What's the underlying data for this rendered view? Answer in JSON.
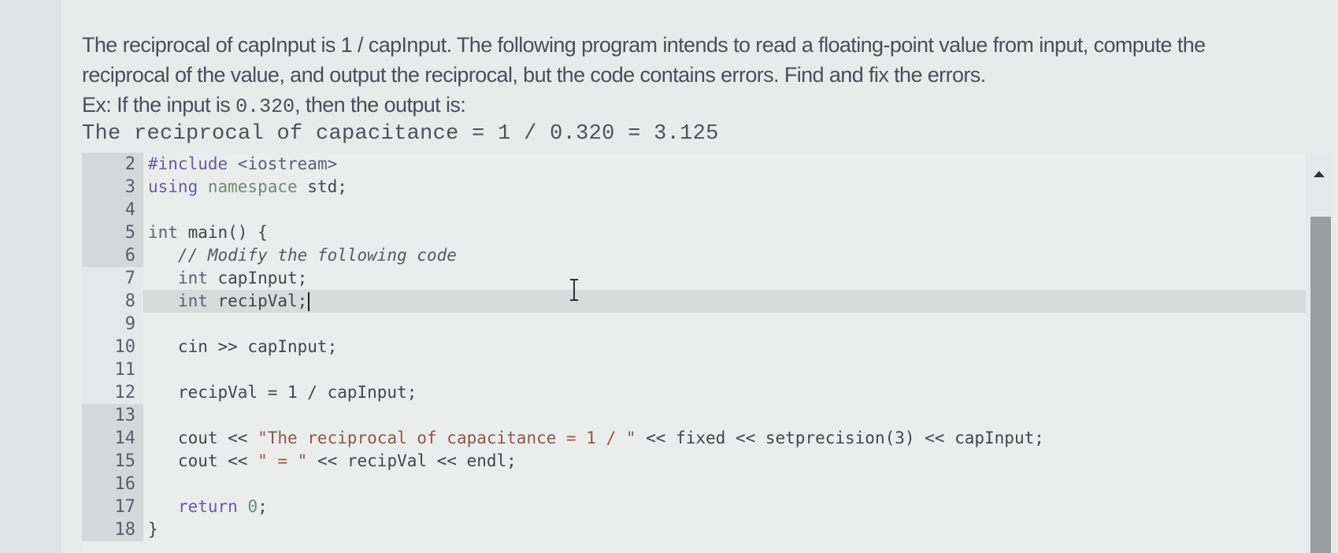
{
  "prompt": {
    "line1": "The reciprocal of capInput is 1 / capInput. The following program intends to read a floating-point value from input, compute the",
    "line2": "reciprocal of the value, and output the reciprocal, but the code contains errors. Find and fix the errors.",
    "line3_prefix": "Ex: If the input is ",
    "line3_value": "0.320",
    "line3_suffix": ", then the output is:",
    "example_output": "The reciprocal of capacitance = 1 / 0.320 = 3.125"
  },
  "editor": {
    "lines": [
      {
        "num": "2",
        "readonly": true
      },
      {
        "num": "3",
        "readonly": true
      },
      {
        "num": "4",
        "readonly": true
      },
      {
        "num": "5",
        "readonly": true
      },
      {
        "num": "6",
        "readonly": true
      },
      {
        "num": "7",
        "readonly": false
      },
      {
        "num": "8",
        "readonly": false,
        "active": true
      },
      {
        "num": "9",
        "readonly": false
      },
      {
        "num": "10",
        "readonly": false
      },
      {
        "num": "11",
        "readonly": false
      },
      {
        "num": "12",
        "readonly": false
      },
      {
        "num": "13",
        "readonly": true
      },
      {
        "num": "14",
        "readonly": true
      },
      {
        "num": "15",
        "readonly": true
      },
      {
        "num": "16",
        "readonly": true
      },
      {
        "num": "17",
        "readonly": true
      },
      {
        "num": "18",
        "readonly": true
      }
    ],
    "code": {
      "l2_directive": "#include",
      "l2_header": " <iostream>",
      "l3_using": "using",
      "l3_namespace": " namespace",
      "l3_rest": " std;",
      "l5_int": "int",
      "l5_rest": " main() {",
      "l6_comment": "   // Modify the following code",
      "l7_indent": "   ",
      "l7_int": "int",
      "l7_rest": " capInput;",
      "l8_indent": "   ",
      "l8_int": "int",
      "l8_rest": " recipVal;",
      "l10": "   cin >> capInput;",
      "l12": "   recipVal = 1 / capInput;",
      "l14_pre": "   cout << ",
      "l14_str": "\"The reciprocal of capacitance = 1 / \"",
      "l14_post": " << fixed << setprecision(3) << capInput;",
      "l15_pre": "   cout << ",
      "l15_str": "\" = \"",
      "l15_post": " << recipVal << endl;",
      "l17_indent": "   ",
      "l17_return": "return",
      "l17_zero": " 0",
      "l17_semi": ";",
      "l18": "}"
    }
  },
  "colors": {
    "keyword": "#6b5a9e",
    "string": "#8a5a4a",
    "namespace": "#6f8a77",
    "readonly_gutter": "#d6d7d8",
    "editable_gutter": "#e6e7e8"
  }
}
